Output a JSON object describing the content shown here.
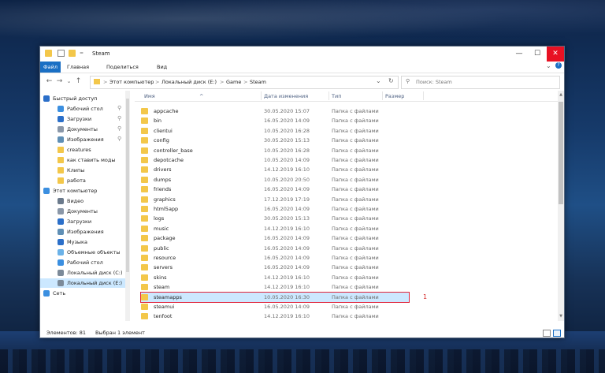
{
  "window": {
    "title": "Steam"
  },
  "ribbon": {
    "tabs": [
      "Файл",
      "Главная",
      "Поделиться",
      "Вид"
    ]
  },
  "address": {
    "path": [
      "Этот компьютер",
      "Локальный диск (E:)",
      "Game",
      "Steam"
    ],
    "separator": ">",
    "chevron": "⌄",
    "refresh": "↻"
  },
  "search": {
    "placeholder": "Поиск: Steam"
  },
  "nav_buttons": {
    "back": "←",
    "forward": "→",
    "recent": "⌄",
    "up": "↑"
  },
  "window_controls": {
    "minimize": "—",
    "maximize": "☐",
    "close": "✕"
  },
  "sidebar": {
    "items": [
      {
        "label": "Быстрый доступ",
        "icon": "star-icon",
        "color": "#2b6fc9",
        "level": 0,
        "pinned": false
      },
      {
        "label": "Рабочий стол",
        "icon": "desktop-icon",
        "color": "#3b8fe0",
        "level": 1,
        "pinned": true
      },
      {
        "label": "Загрузки",
        "icon": "download-icon",
        "color": "#2b6fc9",
        "level": 1,
        "pinned": true
      },
      {
        "label": "Документы",
        "icon": "documents-icon",
        "color": "#8a97a8",
        "level": 1,
        "pinned": true
      },
      {
        "label": "Изображения",
        "icon": "pictures-icon",
        "color": "#5f8fb5",
        "level": 1,
        "pinned": true
      },
      {
        "label": "creatures",
        "icon": "folder-icon",
        "color": "#f3c74a",
        "level": 1,
        "pinned": false
      },
      {
        "label": "как ставить моды",
        "icon": "folder-icon",
        "color": "#f3c74a",
        "level": 1,
        "pinned": false
      },
      {
        "label": "Клипы",
        "icon": "folder-icon",
        "color": "#f3c74a",
        "level": 1,
        "pinned": false
      },
      {
        "label": "работа",
        "icon": "folder-icon",
        "color": "#f3c74a",
        "level": 1,
        "pinned": false
      },
      {
        "label": "Этот компьютер",
        "icon": "computer-icon",
        "color": "#3b8fe0",
        "level": 0,
        "pinned": false
      },
      {
        "label": "Видео",
        "icon": "video-icon",
        "color": "#6b7a8c",
        "level": 1,
        "pinned": false
      },
      {
        "label": "Документы",
        "icon": "documents-icon",
        "color": "#8a97a8",
        "level": 1,
        "pinned": false
      },
      {
        "label": "Загрузки",
        "icon": "download-icon",
        "color": "#2b6fc9",
        "level": 1,
        "pinned": false
      },
      {
        "label": "Изображения",
        "icon": "pictures-icon",
        "color": "#5f8fb5",
        "level": 1,
        "pinned": false
      },
      {
        "label": "Музыка",
        "icon": "music-icon",
        "color": "#2b6fc9",
        "level": 1,
        "pinned": false
      },
      {
        "label": "Объемные объекты",
        "icon": "3d-objects-icon",
        "color": "#6bb2e8",
        "level": 1,
        "pinned": false
      },
      {
        "label": "Рабочий стол",
        "icon": "desktop-icon",
        "color": "#3b8fe0",
        "level": 1,
        "pinned": false
      },
      {
        "label": "Локальный диск (C:)",
        "icon": "drive-icon",
        "color": "#7c8a99",
        "level": 1,
        "pinned": false
      },
      {
        "label": "Локальный диск (E:)",
        "icon": "drive-icon",
        "color": "#7c8a99",
        "level": 1,
        "pinned": false,
        "selected": true
      },
      {
        "label": "Сеть",
        "icon": "network-icon",
        "color": "#3b8fe0",
        "level": 0,
        "pinned": false
      }
    ]
  },
  "columns": [
    "Имя",
    "Дата изменения",
    "Тип",
    "Размер"
  ],
  "files": [
    {
      "name": "appcache",
      "date": "30.05.2020 15:07",
      "type": "Папка с файлами"
    },
    {
      "name": "bin",
      "date": "16.05.2020 14:09",
      "type": "Папка с файлами"
    },
    {
      "name": "clientui",
      "date": "10.05.2020 16:28",
      "type": "Папка с файлами"
    },
    {
      "name": "config",
      "date": "30.05.2020 15:13",
      "type": "Папка с файлами"
    },
    {
      "name": "controller_base",
      "date": "10.05.2020 16:28",
      "type": "Папка с файлами"
    },
    {
      "name": "depotcache",
      "date": "10.05.2020 14:09",
      "type": "Папка с файлами"
    },
    {
      "name": "drivers",
      "date": "14.12.2019 16:10",
      "type": "Папка с файлами"
    },
    {
      "name": "dumps",
      "date": "10.05.2020 20:50",
      "type": "Папка с файлами"
    },
    {
      "name": "friends",
      "date": "16.05.2020 14:09",
      "type": "Папка с файлами"
    },
    {
      "name": "graphics",
      "date": "17.12.2019 17:19",
      "type": "Папка с файлами"
    },
    {
      "name": "html5app",
      "date": "16.05.2020 14:09",
      "type": "Папка с файлами"
    },
    {
      "name": "logs",
      "date": "30.05.2020 15:13",
      "type": "Папка с файлами"
    },
    {
      "name": "music",
      "date": "14.12.2019 16:10",
      "type": "Папка с файлами"
    },
    {
      "name": "package",
      "date": "16.05.2020 14:09",
      "type": "Папка с файлами"
    },
    {
      "name": "public",
      "date": "16.05.2020 14:09",
      "type": "Папка с файлами"
    },
    {
      "name": "resource",
      "date": "16.05.2020 14:09",
      "type": "Папка с файлами"
    },
    {
      "name": "servers",
      "date": "16.05.2020 14:09",
      "type": "Папка с файлами"
    },
    {
      "name": "skins",
      "date": "14.12.2019 16:10",
      "type": "Папка с файлами"
    },
    {
      "name": "steam",
      "date": "14.12.2019 16:10",
      "type": "Папка с файлами"
    },
    {
      "name": "steamapps",
      "date": "10.05.2020 16:30",
      "type": "Папка с файлами",
      "highlighted": true
    },
    {
      "name": "steamui",
      "date": "16.05.2020 14:09",
      "type": "Папка с файлами"
    },
    {
      "name": "tenfoot",
      "date": "14.12.2019 16:10",
      "type": "Папка с файлами"
    }
  ],
  "annotation": {
    "label": "1",
    "color": "#d42a2a"
  },
  "status": {
    "count": "Элементов: 81",
    "selected": "Выбран 1 элемент"
  },
  "colors": {
    "accent": "#1a6fc4",
    "selection": "#cce8ff",
    "highlight_border": "#e0233a",
    "folder": "#f3c74a"
  }
}
